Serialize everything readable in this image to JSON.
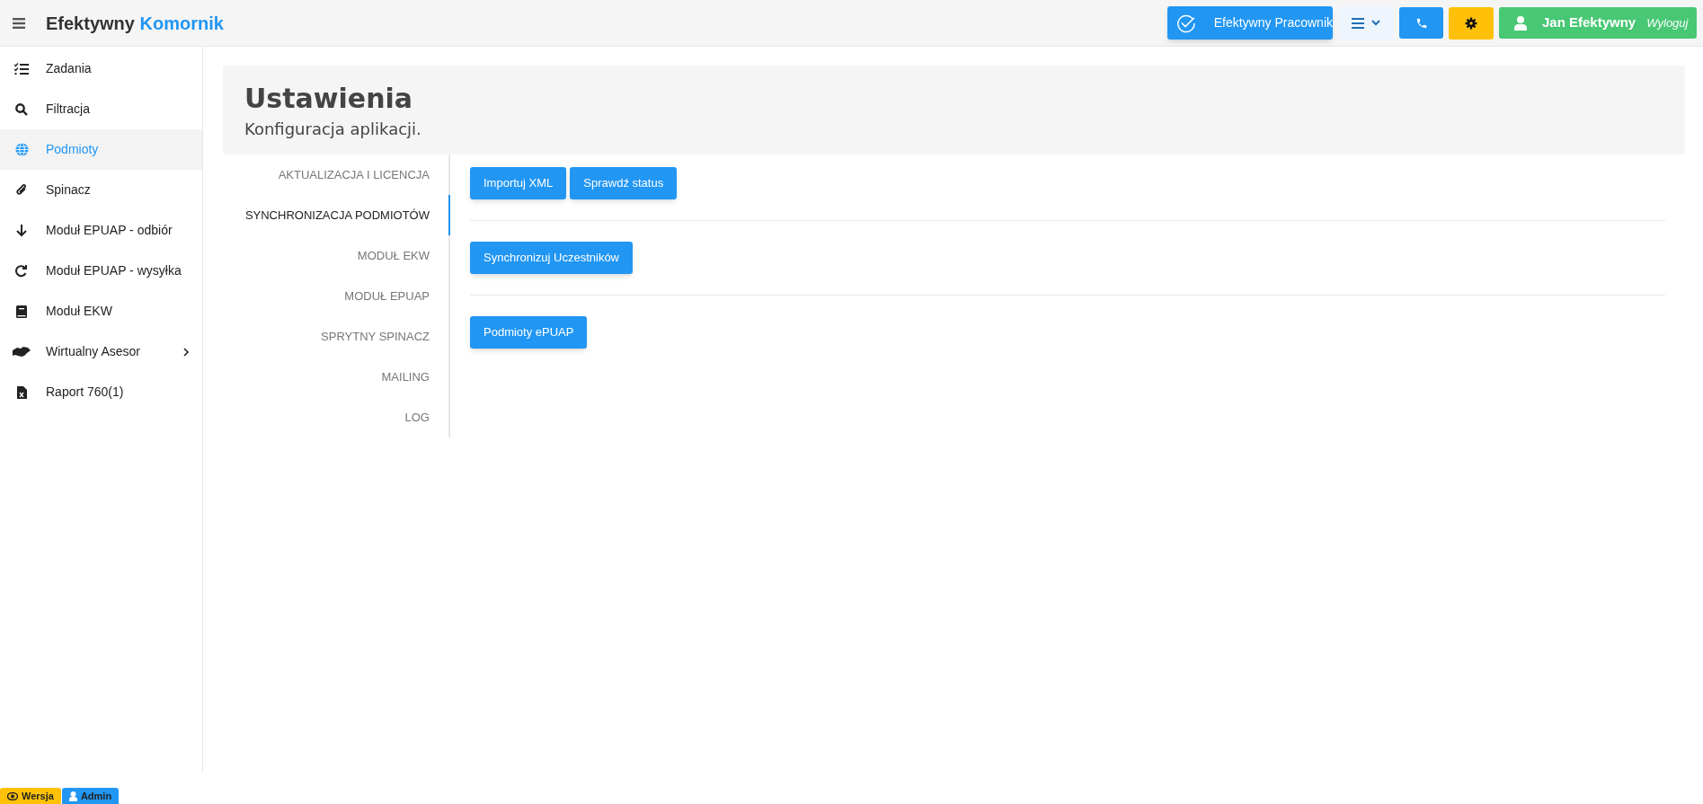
{
  "topbar": {
    "brand_dark": "Efektywny",
    "brand_accent": "Komornik",
    "worker_button": "Efektywny Pracownik",
    "user_name": "Jan Efektywny",
    "logout": "Wyloguj"
  },
  "sidebar": {
    "items": [
      {
        "label": "Zadania",
        "selected": false
      },
      {
        "label": "Filtracja",
        "selected": false
      },
      {
        "label": "Podmioty",
        "selected": true
      },
      {
        "label": "Spinacz",
        "selected": false
      },
      {
        "label": "Moduł EPUAP - odbiór",
        "selected": false
      },
      {
        "label": "Moduł EPUAP - wysyłka",
        "selected": false
      },
      {
        "label": "Moduł EKW",
        "selected": false
      },
      {
        "label": "Wirtualny Asesor",
        "selected": false,
        "expanded": false
      },
      {
        "label": "Raport 760(1)",
        "selected": false
      }
    ]
  },
  "header": {
    "title": "Ustawienia",
    "subtitle": "Konfiguracja aplikacji."
  },
  "tabs": [
    {
      "label": "AKTUALIZACJA I LICENCJA",
      "selected": false
    },
    {
      "label": "SYNCHRONIZACJA PODMIOTÓW",
      "selected": true
    },
    {
      "label": "MODUŁ EKW",
      "selected": false
    },
    {
      "label": "MODUŁ EPUAP",
      "selected": false
    },
    {
      "label": "SPRYTNY SPINACZ",
      "selected": false
    },
    {
      "label": "MAILING",
      "selected": false
    },
    {
      "label": "LOG",
      "selected": false
    }
  ],
  "button_groups": [
    [
      "Importuj XML",
      "Sprawdź status"
    ],
    [
      "Synchronizuj Uczestników"
    ],
    [
      "Podmioty ePUAP"
    ]
  ],
  "footer_badges": [
    {
      "label": "Wersja",
      "color": "#ffc107"
    },
    {
      "label": "Admin",
      "color": "#2196f3"
    }
  ]
}
